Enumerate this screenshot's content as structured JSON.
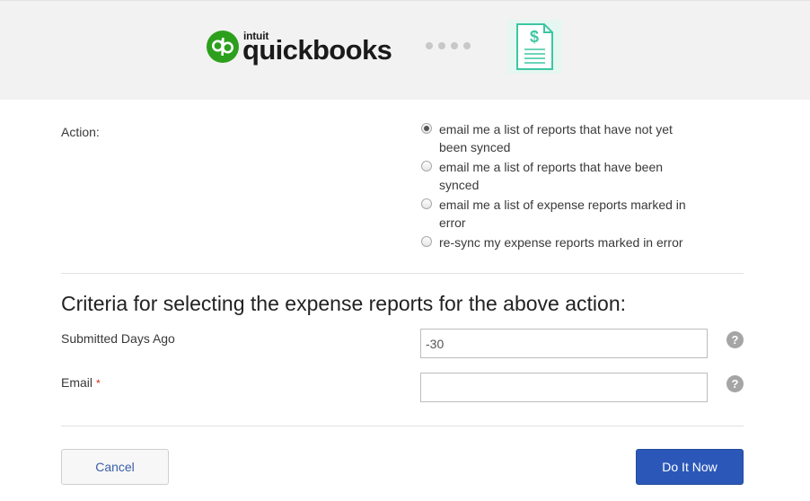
{
  "header": {
    "brand_small": "intuit",
    "brand_name": "quickbooks",
    "brand_color": "#2ca01c",
    "connector_icon": "progress-dots-icon",
    "target_icon": "expense-report-document-icon"
  },
  "action": {
    "label": "Action:",
    "options": [
      {
        "label": "email me a list of reports that have not yet been synced",
        "checked": true
      },
      {
        "label": "email me a list of reports that have been synced",
        "checked": false
      },
      {
        "label": "email me a list of expense reports marked in error",
        "checked": false
      },
      {
        "label": "re-sync my expense reports marked in error",
        "checked": false
      }
    ]
  },
  "criteria": {
    "title": "Criteria for selecting the expense reports for the above action:",
    "submitted_days": {
      "label": "Submitted Days Ago",
      "value": "-30",
      "help": "?"
    },
    "email": {
      "label": "Email",
      "required_marker": "*",
      "value": "",
      "help": "?"
    }
  },
  "buttons": {
    "cancel": "Cancel",
    "submit": "Do It Now"
  }
}
